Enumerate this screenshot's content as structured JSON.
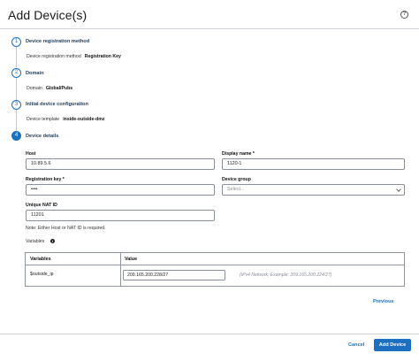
{
  "dialog": {
    "title": "Add Device(s)",
    "help_icon": "question-circle-icon"
  },
  "steps": [
    {
      "number": "1",
      "title": "Device registration method",
      "value_label": "Device registration method",
      "value": "Registration Key"
    },
    {
      "number": "2",
      "title": "Domain",
      "value_label": "Domain",
      "value": "Global/Pubs"
    },
    {
      "number": "3",
      "title": "Initial device configuration",
      "value_label": "Device template",
      "value": "inside-outside-dmz"
    },
    {
      "number": "4",
      "title": "Device details"
    }
  ],
  "form": {
    "host": {
      "label": "Host",
      "value": "10.89.5.6"
    },
    "display_name": {
      "label": "Display name *",
      "value": "1120-1"
    },
    "registration_key": {
      "label": "Registration key *",
      "value": "••••"
    },
    "device_group": {
      "label": "Device group",
      "placeholder": "Select..."
    },
    "unique_nat_id": {
      "label": "Unique NAT ID",
      "value": "11201"
    },
    "note": "Note: Either Host or NAT ID is required."
  },
  "variables": {
    "label": "Variables",
    "info_icon": "info-icon",
    "columns": [
      "Variables",
      "Value"
    ],
    "rows": [
      {
        "name": "$outside_ip",
        "value": "209.165.200.228/27",
        "hint": "(IPv4 Network; Example: 209.165.200.224/27)"
      }
    ]
  },
  "actions": {
    "previous": "Previous",
    "cancel": "Cancel",
    "add_device": "Add Device"
  },
  "colors": {
    "accent": "#1d6fbf"
  }
}
